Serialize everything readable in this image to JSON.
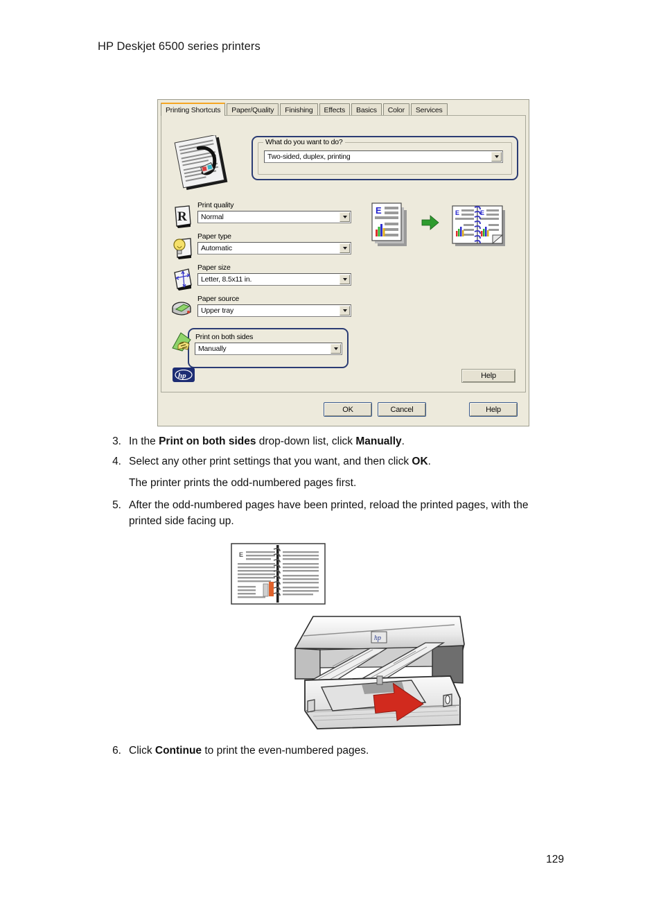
{
  "document": {
    "header": "HP Deskjet 6500 series printers",
    "page_number": "129"
  },
  "dialog": {
    "tabs": [
      {
        "label": "Printing Shortcuts",
        "active": true
      },
      {
        "label": "Paper/Quality",
        "active": false
      },
      {
        "label": "Finishing",
        "active": false
      },
      {
        "label": "Effects",
        "active": false
      },
      {
        "label": "Basics",
        "active": false
      },
      {
        "label": "Color",
        "active": false
      },
      {
        "label": "Services",
        "active": false
      }
    ],
    "what_do_you_want": {
      "legend": "What do you want to do?",
      "value": "Two-sided, duplex, printing"
    },
    "settings": [
      {
        "icon": "print-quality-icon",
        "label": "Print quality",
        "value": "Normal"
      },
      {
        "icon": "paper-type-icon",
        "label": "Paper type",
        "value": "Automatic"
      },
      {
        "icon": "paper-size-icon",
        "label": "Paper size",
        "value": "Letter, 8.5x11 in."
      },
      {
        "icon": "paper-source-icon",
        "label": "Paper source",
        "value": "Upper tray"
      }
    ],
    "both_sides": {
      "icon": "print-both-sides-icon",
      "label": "Print on both sides",
      "value": "Manually"
    },
    "logo": "hp-logo",
    "panel_help_label": "Help",
    "footer_buttons": [
      {
        "label": "OK",
        "name": "ok-button"
      },
      {
        "label": "Cancel",
        "name": "cancel-button"
      },
      {
        "label": "Help",
        "name": "help-button"
      }
    ],
    "colors": {
      "dialog_background": "#EDEADC",
      "highlight_border": "#2b3c74",
      "active_tab_accent": "#F5A623",
      "hp_blue": "#1d2d73",
      "arrow_red": "#D12A1E",
      "arrow_green": "#2E9B2E"
    }
  },
  "steps": [
    {
      "number": "3.",
      "parts": [
        {
          "text": "In the ",
          "bold": false
        },
        {
          "text": "Print on both sides",
          "bold": true
        },
        {
          "text": " drop-down list, click ",
          "bold": false
        },
        {
          "text": "Manually",
          "bold": true
        },
        {
          "text": ".",
          "bold": false
        }
      ]
    },
    {
      "number": "4.",
      "parts": [
        {
          "text": "Select any other print settings that you want, and then click ",
          "bold": false
        },
        {
          "text": "OK",
          "bold": true
        },
        {
          "text": ".",
          "bold": false
        }
      ]
    },
    {
      "number": "",
      "parts": [
        {
          "text": "The printer prints the odd-numbered pages first.",
          "bold": false
        }
      ]
    },
    {
      "number": "5.",
      "parts": [
        {
          "text": "After the odd-numbered pages have been printed, reload the printed pages, with the printed side facing up.",
          "bold": false
        }
      ]
    }
  ],
  "step6": {
    "number": "6.",
    "parts": [
      {
        "text": "Click ",
        "bold": false
      },
      {
        "text": "Continue",
        "bold": true
      },
      {
        "text": " to print the even-numbered pages.",
        "bold": false
      }
    ]
  },
  "figures": {
    "book": "open-spiral-book-illustration",
    "printer": "printer-reload-paper-illustration"
  }
}
